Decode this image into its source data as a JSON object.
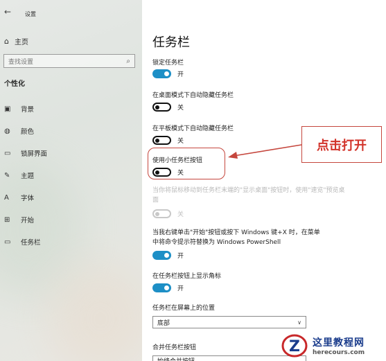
{
  "window": {
    "title": "设置"
  },
  "sidebar": {
    "home": "主页",
    "search_placeholder": "查找设置",
    "section": "个性化",
    "items": [
      {
        "label": "背景",
        "icon": "image-icon"
      },
      {
        "label": "颜色",
        "icon": "palette-icon"
      },
      {
        "label": "锁屏界面",
        "icon": "lock-screen-icon"
      },
      {
        "label": "主题",
        "icon": "brush-icon"
      },
      {
        "label": "字体",
        "icon": "font-icon"
      },
      {
        "label": "开始",
        "icon": "start-icon"
      },
      {
        "label": "任务栏",
        "icon": "taskbar-icon"
      }
    ]
  },
  "main": {
    "title": "任务栏",
    "settings": [
      {
        "label": "锁定任务栏",
        "state": "开",
        "on": true
      },
      {
        "label": "在桌面模式下自动隐藏任务栏",
        "state": "关",
        "on": false
      },
      {
        "label": "在平板模式下自动隐藏任务栏",
        "state": "关",
        "on": false
      },
      {
        "label": "使用小任务栏按钮",
        "state": "关",
        "on": false
      },
      {
        "label": "当你将鼠标移动到任务栏末端的\"显示桌面\"按钮时，使用\"速览\"预览桌面",
        "state": "关",
        "on": false,
        "disabled": true
      },
      {
        "label": "当我右键单击\"开始\"按钮或按下 Windows 键+X 时，在菜单中将命令提示符替换为 Windows PowerShell",
        "state": "开",
        "on": true
      },
      {
        "label": "在任务栏按钮上显示角标",
        "state": "开",
        "on": true
      }
    ],
    "position_label": "任务栏在屏幕上的位置",
    "position_value": "底部",
    "combine_label": "合并任务栏按钮",
    "combine_value": "始终合并按钮"
  },
  "annotation": {
    "callout": "点击打开",
    "color": "#c5463d"
  },
  "watermark": {
    "cn": "这里教程网",
    "en": "herecours.com"
  },
  "colors": {
    "accent": "#1d8fc6"
  }
}
